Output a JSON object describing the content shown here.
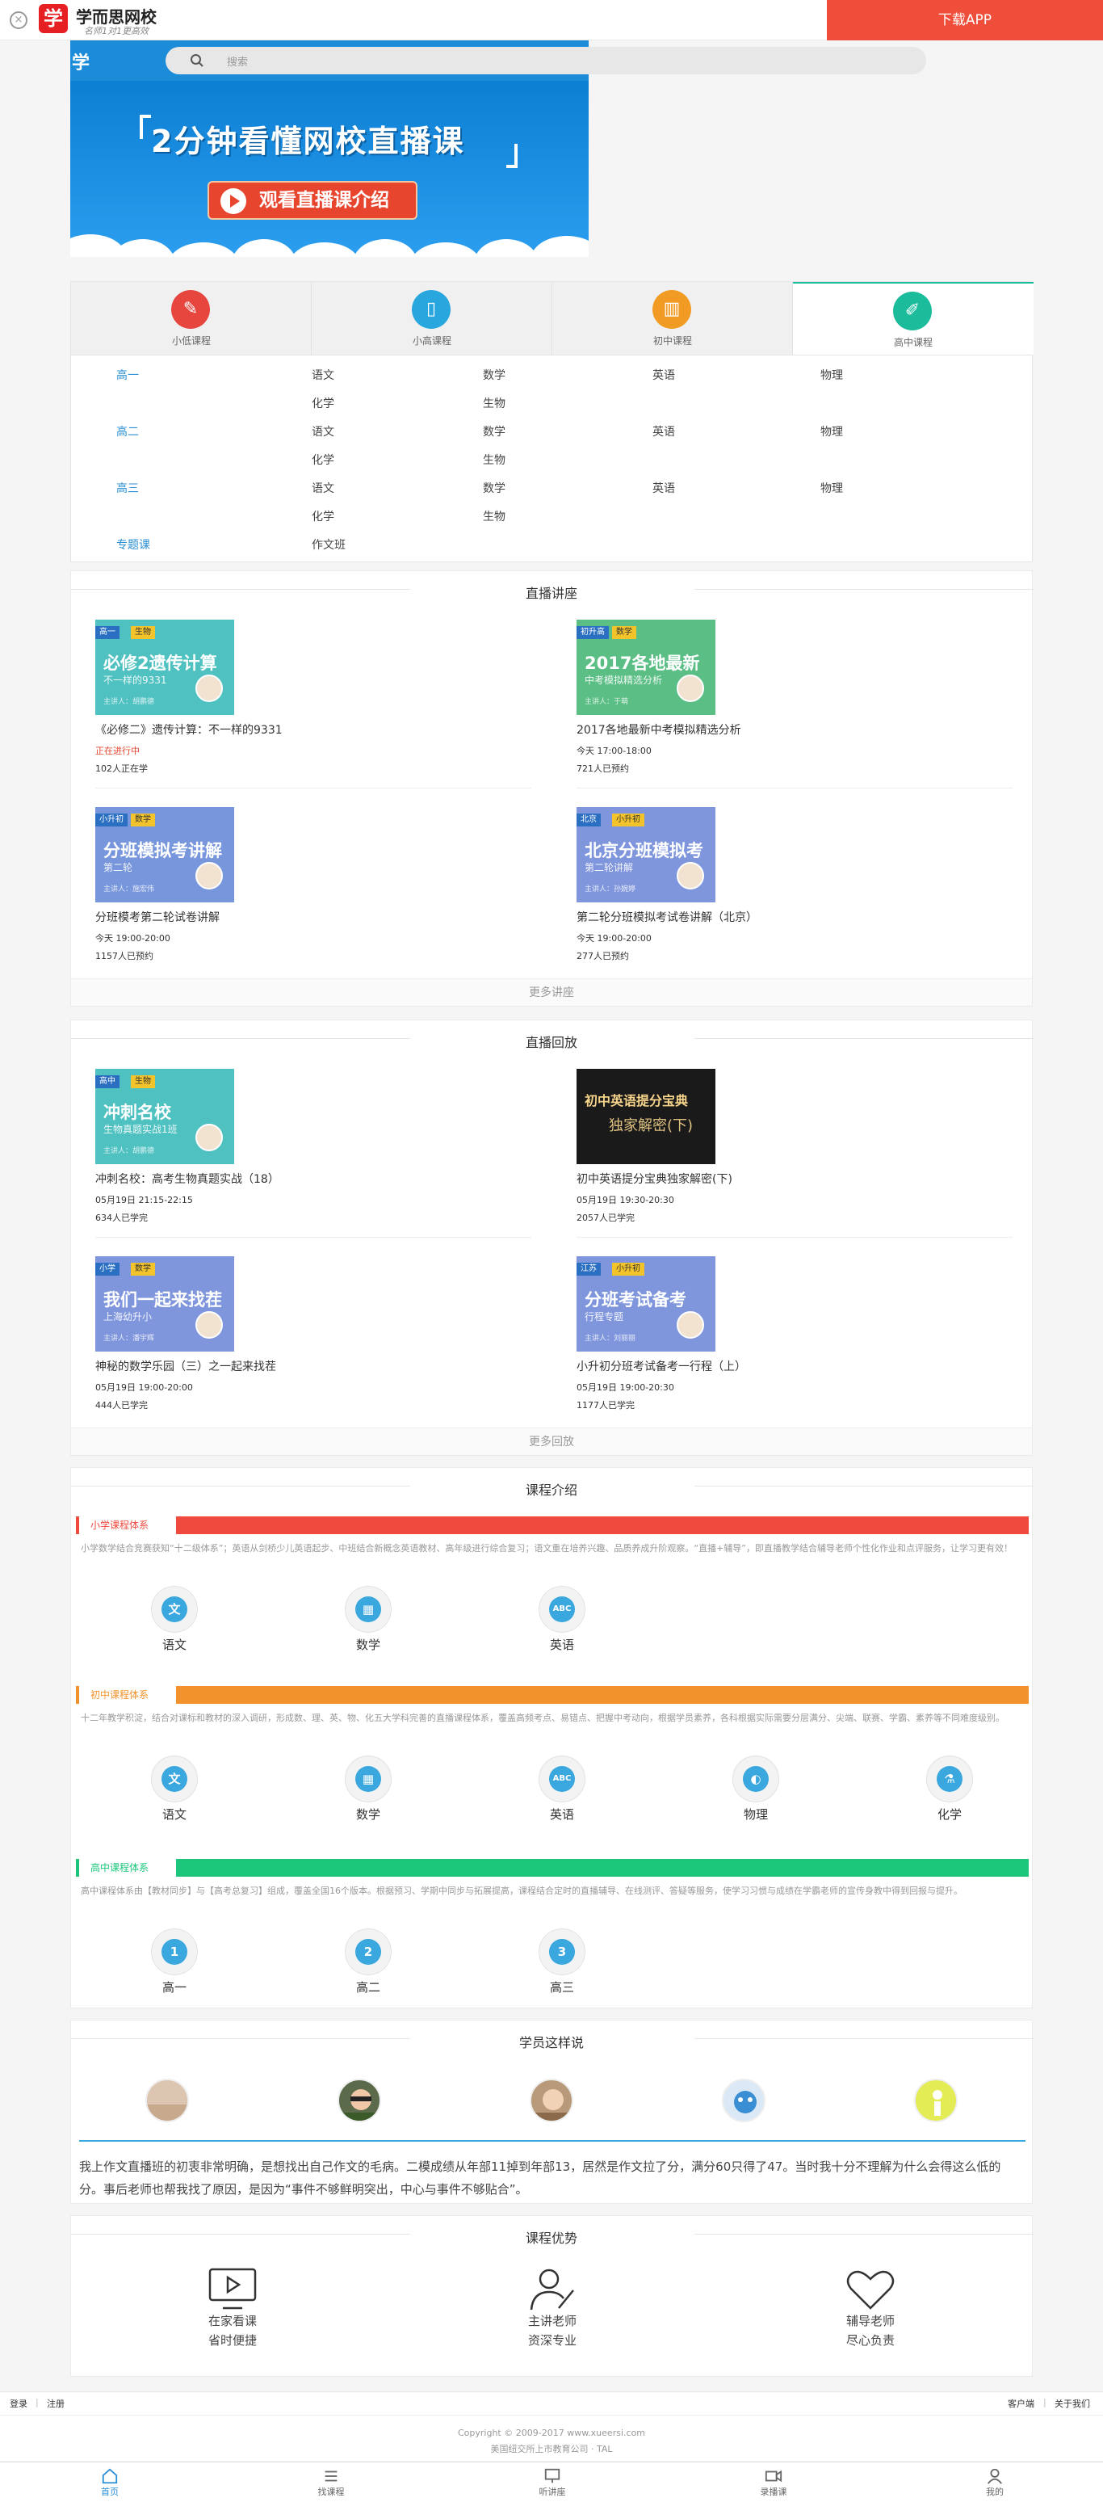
{
  "topbar": {
    "close_symbol": "×",
    "logo_char": "学",
    "app_name": "学而思网校",
    "slogan": "名师1对1更高效",
    "download_label": "下载APP"
  },
  "header": {
    "logo_char": "学"
  },
  "search": {
    "placeholder": "搜索"
  },
  "banner": {
    "title": "2分钟看懂网校直播课",
    "button_label": "观看直播课介绍"
  },
  "grade_tabs": [
    {
      "label": "小低课程",
      "color": "#e6463d",
      "icon": "pencil-icon",
      "active": false
    },
    {
      "label": "小高课程",
      "color": "#27a7dd",
      "icon": "book-icon",
      "active": false
    },
    {
      "label": "初中课程",
      "color": "#f29b24",
      "icon": "books-icon",
      "active": false
    },
    {
      "label": "高中课程",
      "color": "#1bbc9b",
      "icon": "eraser-icon",
      "active": true
    }
  ],
  "subject_rows": [
    {
      "grade": "高一",
      "subjects": [
        "语文",
        "数学",
        "英语",
        "物理",
        "化学",
        "生物"
      ]
    },
    {
      "grade": "高二",
      "subjects": [
        "语文",
        "数学",
        "英语",
        "物理",
        "化学",
        "生物"
      ]
    },
    {
      "grade": "高三",
      "subjects": [
        "语文",
        "数学",
        "英语",
        "物理",
        "化学",
        "生物"
      ]
    },
    {
      "grade": "专题课",
      "subjects": [
        "作文班"
      ]
    }
  ],
  "live": {
    "title": "直播讲座",
    "more": "更多讲座",
    "courses": [
      {
        "tag1": "高一",
        "tag2": "生物",
        "thumb_title": "必修2遗传计算",
        "thumb_sub": "不一样的9331",
        "thumb_teacher": "主讲人：胡鹏德",
        "name": "《必修二》遗传计算：不一样的9331",
        "line1": "正在进行中",
        "line2": "102人正在学",
        "bg": "#4fc1c1",
        "line1_red": true
      },
      {
        "tag1": "初升高",
        "tag2": "数学",
        "thumb_title": "2017各地最新",
        "thumb_sub": "中考模拟精选分析",
        "thumb_teacher": "主讲人：于萌",
        "name": "2017各地最新中考模拟精选分析",
        "line1": "今天  17:00-18:00",
        "line2": "721人已预约",
        "bg": "#5bbf85",
        "line1_red": false
      },
      {
        "tag1": "小升初",
        "tag2": "数学",
        "thumb_title": "分班模拟考讲解",
        "thumb_sub": "第二轮",
        "thumb_teacher": "主讲人：施宏伟",
        "name": "分班模考第二轮试卷讲解",
        "line1": "今天  19:00-20:00",
        "line2": "1157人已预约",
        "bg": "#7896dc",
        "line1_red": false
      },
      {
        "tag1": "北京",
        "tag2": "小升初",
        "thumb_title": "北京分班模拟考",
        "thumb_sub": "第二轮讲解",
        "thumb_teacher": "主讲人：孙婉婷",
        "name": "第二轮分班模拟考试卷讲解（北京）",
        "line1": "今天  19:00-20:00",
        "line2": "277人已预约",
        "bg": "#7f96dc",
        "line1_red": false
      }
    ]
  },
  "replay": {
    "title": "直播回放",
    "more": "更多回放",
    "courses": [
      {
        "tag1": "高中",
        "tag2": "生物",
        "thumb_title": "冲刺名校",
        "thumb_sub": "生物真题实战1班",
        "thumb_teacher": "主讲人：胡鹏德",
        "name": "冲刺名校：高考生物真题实战（18）",
        "line1": "05月19日  21:15-22:15",
        "line2": "634人已学完",
        "bg": "#4fc1c1"
      },
      {
        "tag1": "",
        "tag2": "",
        "thumb_title": "初中英语提分宝典",
        "thumb_sub": "独家解密(下)",
        "thumb_teacher": "",
        "name": "初中英语提分宝典独家解密(下)",
        "line1": "05月19日  19:30-20:30",
        "line2": "2057人已学完",
        "bg": "#1a1a1a"
      },
      {
        "tag1": "小学",
        "tag2": "数学",
        "thumb_title": "我们一起来找茬",
        "thumb_sub": "上海幼升小",
        "thumb_teacher": "主讲人：潘宇辉",
        "name": "神秘的数学乐园（三）之一起来找茬",
        "line1": "05月19日  19:00-20:00",
        "line2": "444人已学完",
        "bg": "#7f96dc"
      },
      {
        "tag1": "江苏",
        "tag2": "小升初",
        "thumb_title": "分班考试备考",
        "thumb_sub": "行程专题",
        "thumb_teacher": "主讲人：刘丽丽",
        "name": "小升初分班考试备考一行程（上）",
        "line1": "05月19日  19:00-20:30",
        "line2": "1177人已学完",
        "bg": "#7f96dc"
      }
    ]
  },
  "intro": {
    "title": "课程介绍",
    "systems": [
      {
        "name": "小学课程体系",
        "color": "#f04a3e",
        "desc": "小学数学结合竞赛获知“十二级体系”；英语从剑桥少儿英语起步、中班结合新概念英语教材、高年级进行综合复习；语文重在培养兴趣、品质养成升阶观察。“直播+辅导”，即直播教学结合辅导老师个性化作业和点评服务，让学习更有效！",
        "subjects": [
          {
            "label": "语文",
            "glyph": "文"
          },
          {
            "label": "数学",
            "glyph": "▦"
          },
          {
            "label": "英语",
            "glyph": "ABC"
          }
        ]
      },
      {
        "name": "初中课程体系",
        "color": "#f2922c",
        "desc": "十二年教学积淀，结合对课标和教材的深入调研，形成数、理、英、物、化五大学科完善的直播课程体系，覆盖高频考点、易错点、把握中考动向，根据学员素养，各科根据实际需要分层满分、尖端、联赛、学霸、素养等不同难度级别。",
        "subjects": [
          {
            "label": "语文",
            "glyph": "文"
          },
          {
            "label": "数学",
            "glyph": "▦"
          },
          {
            "label": "英语",
            "glyph": "ABC"
          },
          {
            "label": "物理",
            "glyph": "◐"
          },
          {
            "label": "化学",
            "glyph": "⚗"
          }
        ]
      },
      {
        "name": "高中课程体系",
        "color": "#1cc77c",
        "desc": "高中课程体系由【教材同步】与【高考总复习】组成，覆盖全国16个版本。根据预习、学期中同步与拓展提高，课程结合定时的直播辅导、在线测评、答疑等服务，使学习习惯与成绩在学霸老师的宣传身教中得到回报与提升。",
        "subjects": [
          {
            "label": "高一",
            "glyph": "1"
          },
          {
            "label": "高二",
            "glyph": "2"
          },
          {
            "label": "高三",
            "glyph": "3"
          }
        ]
      }
    ]
  },
  "students": {
    "title": "学员这样说",
    "avatars": [
      "avatar-1",
      "avatar-2",
      "avatar-3",
      "avatar-4",
      "avatar-5"
    ],
    "quote": "我上作文直播班的初衷非常明确，是想找出自己作文的毛病。二模成绩从年部11掉到年部13，居然是作文拉了分，满分60只得了47。当时我十分不理解为什么会得这么低的分。事后老师也帮我找了原因，是因为“事件不够鲜明突出，中心与事件不够贴合”。"
  },
  "advantage": {
    "title": "课程优势",
    "items": [
      {
        "line1": "在家看课",
        "line2": "省时便捷",
        "icon": "monitor-play-icon"
      },
      {
        "line1": "主讲老师",
        "line2": "资深专业",
        "icon": "teacher-pen-icon"
      },
      {
        "line1": "辅导老师",
        "line2": "尽心负责",
        "icon": "heart-icon"
      }
    ]
  },
  "footer": {
    "login": "登录",
    "sep": "|",
    "register": "注册",
    "client": "客户端",
    "about": "关于我们",
    "copyright": "Copyright © 2009-2017 www.xueersi.com",
    "company": "美国纽交所上市教育公司 · TAL"
  },
  "tabbar": [
    {
      "label": "首页",
      "icon": "home-icon",
      "active": true
    },
    {
      "label": "找课程",
      "icon": "list-icon",
      "active": false
    },
    {
      "label": "听讲座",
      "icon": "lecture-icon",
      "active": false
    },
    {
      "label": "录播课",
      "icon": "video-icon",
      "active": false
    },
    {
      "label": "我的",
      "icon": "user-icon",
      "active": false
    }
  ],
  "colors": {
    "brand_red": "#e51f22",
    "blue": "#2a8fd4",
    "download_bg": "#ef4e3b",
    "header_blue": "#1c8cd8"
  }
}
